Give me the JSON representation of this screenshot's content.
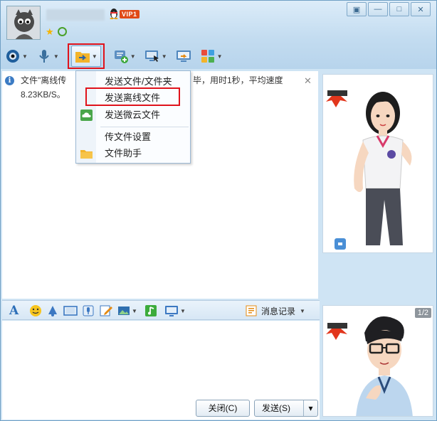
{
  "window": {
    "controls": [
      "▣",
      "—",
      "□",
      "✕"
    ]
  },
  "profile": {
    "vip_label": "VIP1"
  },
  "toolbar": {
    "items": [
      "video-call",
      "voice-call",
      "send-file",
      "screenshot-msg",
      "remote-desktop",
      "share-screen",
      "apps"
    ]
  },
  "notice": {
    "line1a": "文件\"离线传",
    "line1b": "毕，用时1秒，平均速度",
    "line2": "8.23KB/S。",
    "close": "✕"
  },
  "file_menu": {
    "items": [
      {
        "label": "发送文件/文件夹"
      },
      {
        "label": "发送离线文件"
      },
      {
        "label": "发送微云文件"
      },
      {
        "label": "传文件设置"
      },
      {
        "label": "文件助手"
      }
    ]
  },
  "input_toolbar": {
    "history_label": "消息记录"
  },
  "right_panel": {
    "page_indicator": "1/2"
  },
  "buttons": {
    "close": "关闭(C)",
    "send": "发送(S)",
    "send_arrow": "▾"
  },
  "colors": {
    "highlight_red": "#e0121b",
    "accent_blue": "#3b7bc4"
  }
}
